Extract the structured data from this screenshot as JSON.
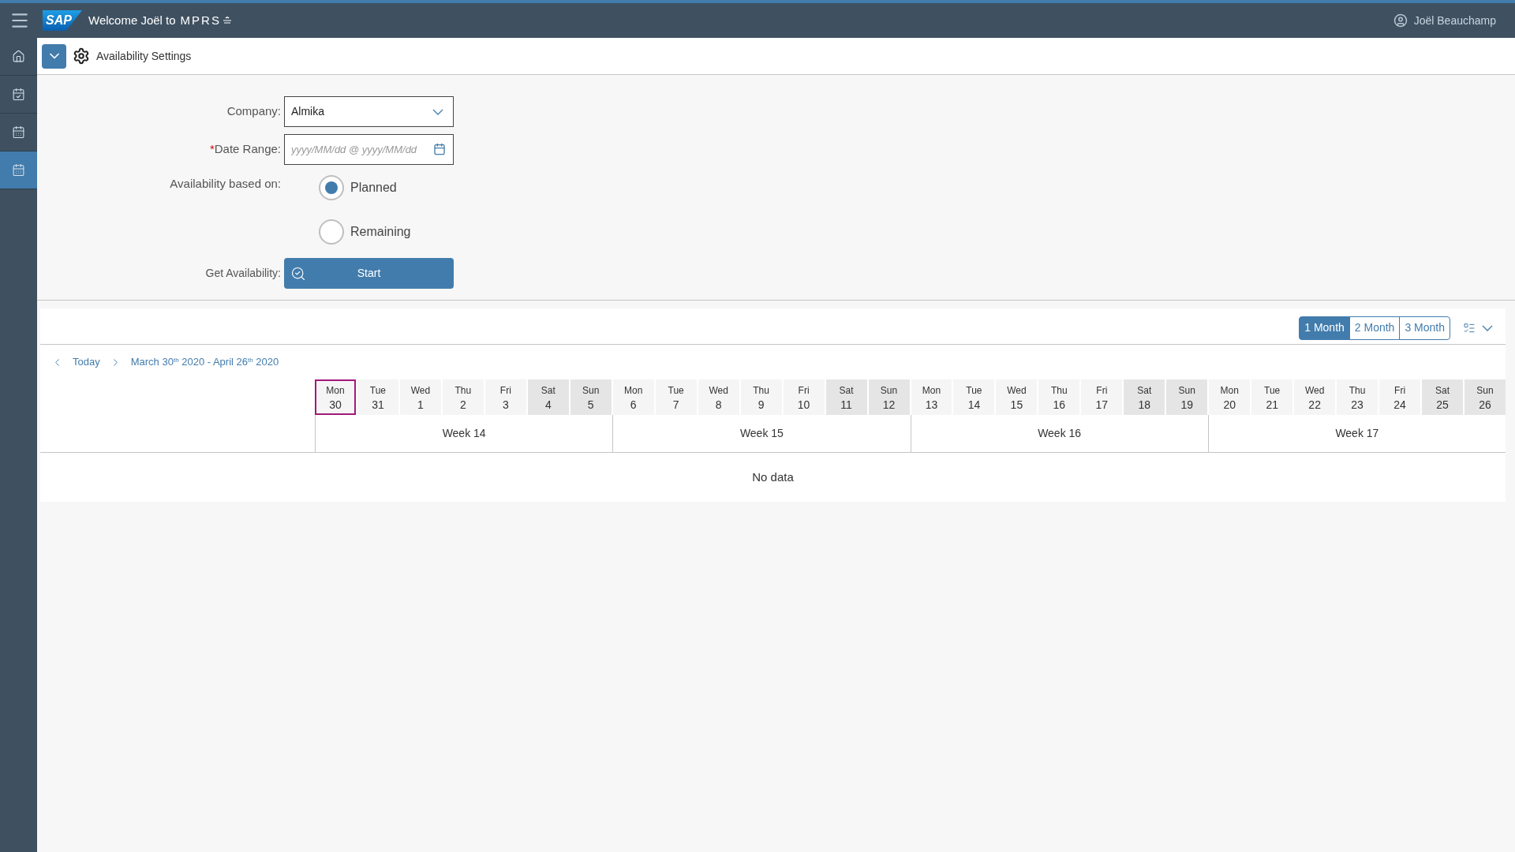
{
  "shell": {
    "logo_text": "SAP",
    "welcome": "Welcome Joël to",
    "brand": "MPRS",
    "user": "Joël Beauchamp"
  },
  "sidebar": {
    "items": [
      {
        "selected": false
      },
      {
        "selected": false
      },
      {
        "selected": false
      },
      {
        "selected": true
      }
    ]
  },
  "page_title": "Availability Settings",
  "form": {
    "company_label": "Company:",
    "company_value": "Almika",
    "date_label": "Date Range:",
    "required_mark": "*",
    "date_placeholder": "yyyy/MM/dd @ yyyy/MM/dd",
    "basis_label": "Availability based on:",
    "options": [
      {
        "label": "Planned",
        "selected": true
      },
      {
        "label": "Remaining",
        "selected": false
      }
    ],
    "get_label": "Get Availability:",
    "start_button": "Start"
  },
  "calendar": {
    "ranges": [
      {
        "label": "1 Month",
        "selected": true
      },
      {
        "label": "2 Month",
        "selected": false
      },
      {
        "label": "3 Month",
        "selected": false
      }
    ],
    "today": "Today",
    "range_text": "March 30$^{th}$  2020 - April 26$^{th}$ 2020",
    "days": [
      {
        "weekday": "Mon",
        "day": "30",
        "weekend": false,
        "selected": true
      },
      {
        "weekday": "Tue",
        "day": "31",
        "weekend": false,
        "selected": false
      },
      {
        "weekday": "Wed",
        "day": "1",
        "weekend": false,
        "selected": false
      },
      {
        "weekday": "Thu",
        "day": "2",
        "weekend": false,
        "selected": false
      },
      {
        "weekday": "Fri",
        "day": "3",
        "weekend": false,
        "selected": false
      },
      {
        "weekday": "Sat",
        "day": "4",
        "weekend": true,
        "selected": false
      },
      {
        "weekday": "Sun",
        "day": "5",
        "weekend": true,
        "selected": false
      },
      {
        "weekday": "Mon",
        "day": "6",
        "weekend": false,
        "selected": false
      },
      {
        "weekday": "Tue",
        "day": "7",
        "weekend": false,
        "selected": false
      },
      {
        "weekday": "Wed",
        "day": "8",
        "weekend": false,
        "selected": false
      },
      {
        "weekday": "Thu",
        "day": "9",
        "weekend": false,
        "selected": false
      },
      {
        "weekday": "Fri",
        "day": "10",
        "weekend": false,
        "selected": false
      },
      {
        "weekday": "Sat",
        "day": "11",
        "weekend": true,
        "selected": false
      },
      {
        "weekday": "Sun",
        "day": "12",
        "weekend": true,
        "selected": false
      },
      {
        "weekday": "Mon",
        "day": "13",
        "weekend": false,
        "selected": false
      },
      {
        "weekday": "Tue",
        "day": "14",
        "weekend": false,
        "selected": false
      },
      {
        "weekday": "Wed",
        "day": "15",
        "weekend": false,
        "selected": false
      },
      {
        "weekday": "Thu",
        "day": "16",
        "weekend": false,
        "selected": false
      },
      {
        "weekday": "Fri",
        "day": "17",
        "weekend": false,
        "selected": false
      },
      {
        "weekday": "Sat",
        "day": "18",
        "weekend": true,
        "selected": false
      },
      {
        "weekday": "Sun",
        "day": "19",
        "weekend": true,
        "selected": false
      },
      {
        "weekday": "Mon",
        "day": "20",
        "weekend": false,
        "selected": false
      },
      {
        "weekday": "Tue",
        "day": "21",
        "weekend": false,
        "selected": false
      },
      {
        "weekday": "Wed",
        "day": "22",
        "weekend": false,
        "selected": false
      },
      {
        "weekday": "Thu",
        "day": "23",
        "weekend": false,
        "selected": false
      },
      {
        "weekday": "Fri",
        "day": "24",
        "weekend": false,
        "selected": false
      },
      {
        "weekday": "Sat",
        "day": "25",
        "weekend": true,
        "selected": false
      },
      {
        "weekday": "Sun",
        "day": "26",
        "weekend": true,
        "selected": false
      }
    ],
    "weeks": [
      "Week 14",
      "Week 15",
      "Week 16",
      "Week 17"
    ],
    "empty_text": "No data"
  }
}
